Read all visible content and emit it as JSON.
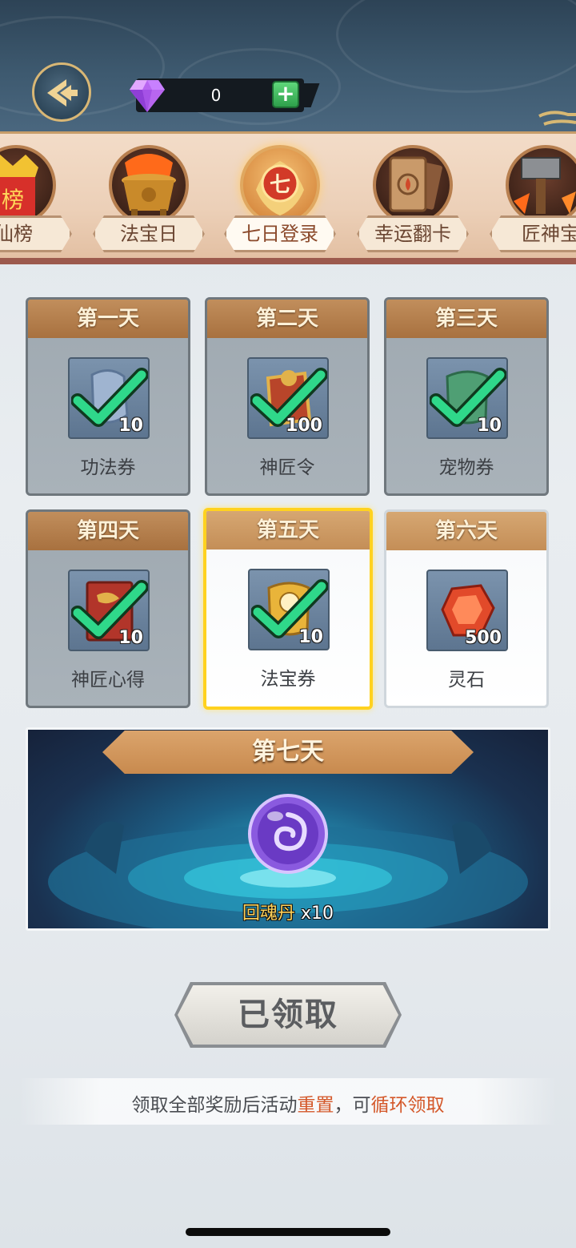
{
  "header": {
    "currency": {
      "value": "0",
      "icon": "diamond-icon",
      "add_icon": "plus-icon"
    }
  },
  "tabs": [
    {
      "label": "秀仙榜",
      "icon_text": "榜",
      "icon": "ranking-icon",
      "active": false
    },
    {
      "label": "法宝日",
      "icon": "cauldron-icon",
      "active": false
    },
    {
      "label": "七日登录",
      "icon_text": "七",
      "icon": "seven-day-login-icon",
      "active": true
    },
    {
      "label": "幸运翻卡",
      "icon": "card-flip-icon",
      "active": false
    },
    {
      "label": "匠神宝库",
      "icon": "hammer-icon",
      "active": false
    }
  ],
  "days": [
    {
      "title": "第一天",
      "item_name": "功法券",
      "count": "10",
      "claimed": true,
      "item_icon": "scroll-voucher-icon"
    },
    {
      "title": "第二天",
      "item_name": "神匠令",
      "count": "100",
      "claimed": true,
      "item_icon": "craft-token-icon"
    },
    {
      "title": "第三天",
      "item_name": "宠物券",
      "count": "10",
      "claimed": true,
      "item_icon": "pet-voucher-icon"
    },
    {
      "title": "第四天",
      "item_name": "神匠心得",
      "count": "10",
      "claimed": true,
      "item_icon": "book-icon"
    },
    {
      "title": "第五天",
      "item_name": "法宝券",
      "count": "10",
      "claimed": true,
      "item_icon": "treasure-voucher-icon"
    },
    {
      "title": "第六天",
      "item_name": "灵石",
      "count": "500",
      "claimed": false,
      "item_icon": "spirit-stone-icon"
    }
  ],
  "day7": {
    "title": "第七天",
    "item_name": "回魂丹",
    "count_text": " x10",
    "item_icon": "soul-orb-icon"
  },
  "claim_button": {
    "label": "已领取"
  },
  "footer_note": {
    "part1": "领取全部奖励后活动",
    "hl1": "重置",
    "part2": "，可",
    "hl2": "循环领取"
  },
  "colors": {
    "accent_gold": "#ffd21f",
    "check_green": "#2fd88a",
    "highlight_orange": "#d4582a"
  }
}
